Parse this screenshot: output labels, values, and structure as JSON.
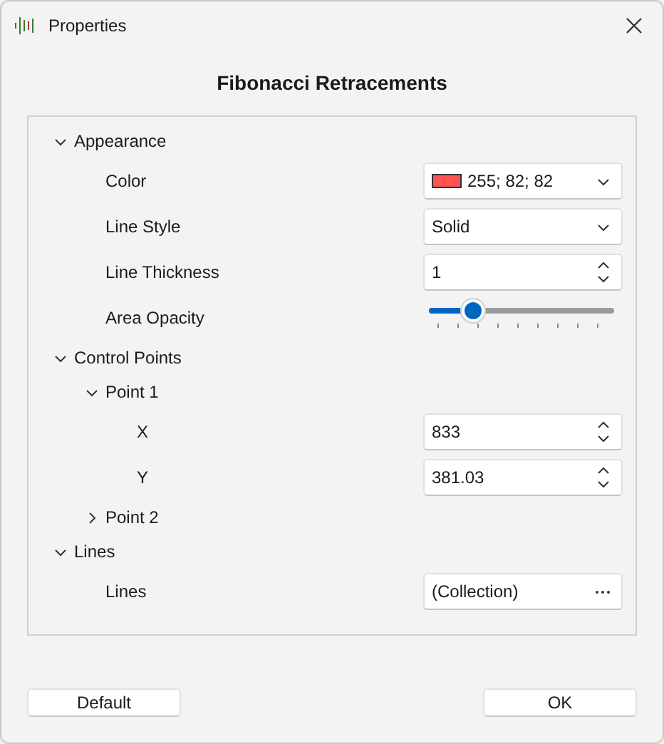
{
  "window": {
    "title": "Properties"
  },
  "heading": "Fibonacci Retracements",
  "tree": [
    {
      "label": "Appearance",
      "expanded": true,
      "children": [
        {
          "label": "Color",
          "editor": {
            "kind": "color",
            "value": "255; 82; 82",
            "color": "#ff5252"
          }
        },
        {
          "label": "Line Style",
          "editor": {
            "kind": "dropdown",
            "value": "Solid"
          }
        },
        {
          "label": "Line Thickness",
          "editor": {
            "kind": "spin",
            "value": "1"
          }
        },
        {
          "label": "Area Opacity",
          "editor": {
            "kind": "slider",
            "level": 0.24
          }
        }
      ]
    },
    {
      "label": "Control Points",
      "expanded": true,
      "children": [
        {
          "label": "Point 1",
          "expanded": true,
          "children": [
            {
              "label": "X",
              "editor": {
                "kind": "spin",
                "value": "833"
              }
            },
            {
              "label": "Y",
              "editor": {
                "kind": "spin",
                "value": "381.03"
              }
            }
          ]
        },
        {
          "label": "Point 2",
          "expanded": false
        }
      ]
    },
    {
      "label": "Lines",
      "expanded": true,
      "children": [
        {
          "label": "Lines",
          "editor": {
            "kind": "collection",
            "value": "(Collection)"
          }
        }
      ]
    }
  ],
  "buttons": [
    "Default",
    "OK"
  ]
}
